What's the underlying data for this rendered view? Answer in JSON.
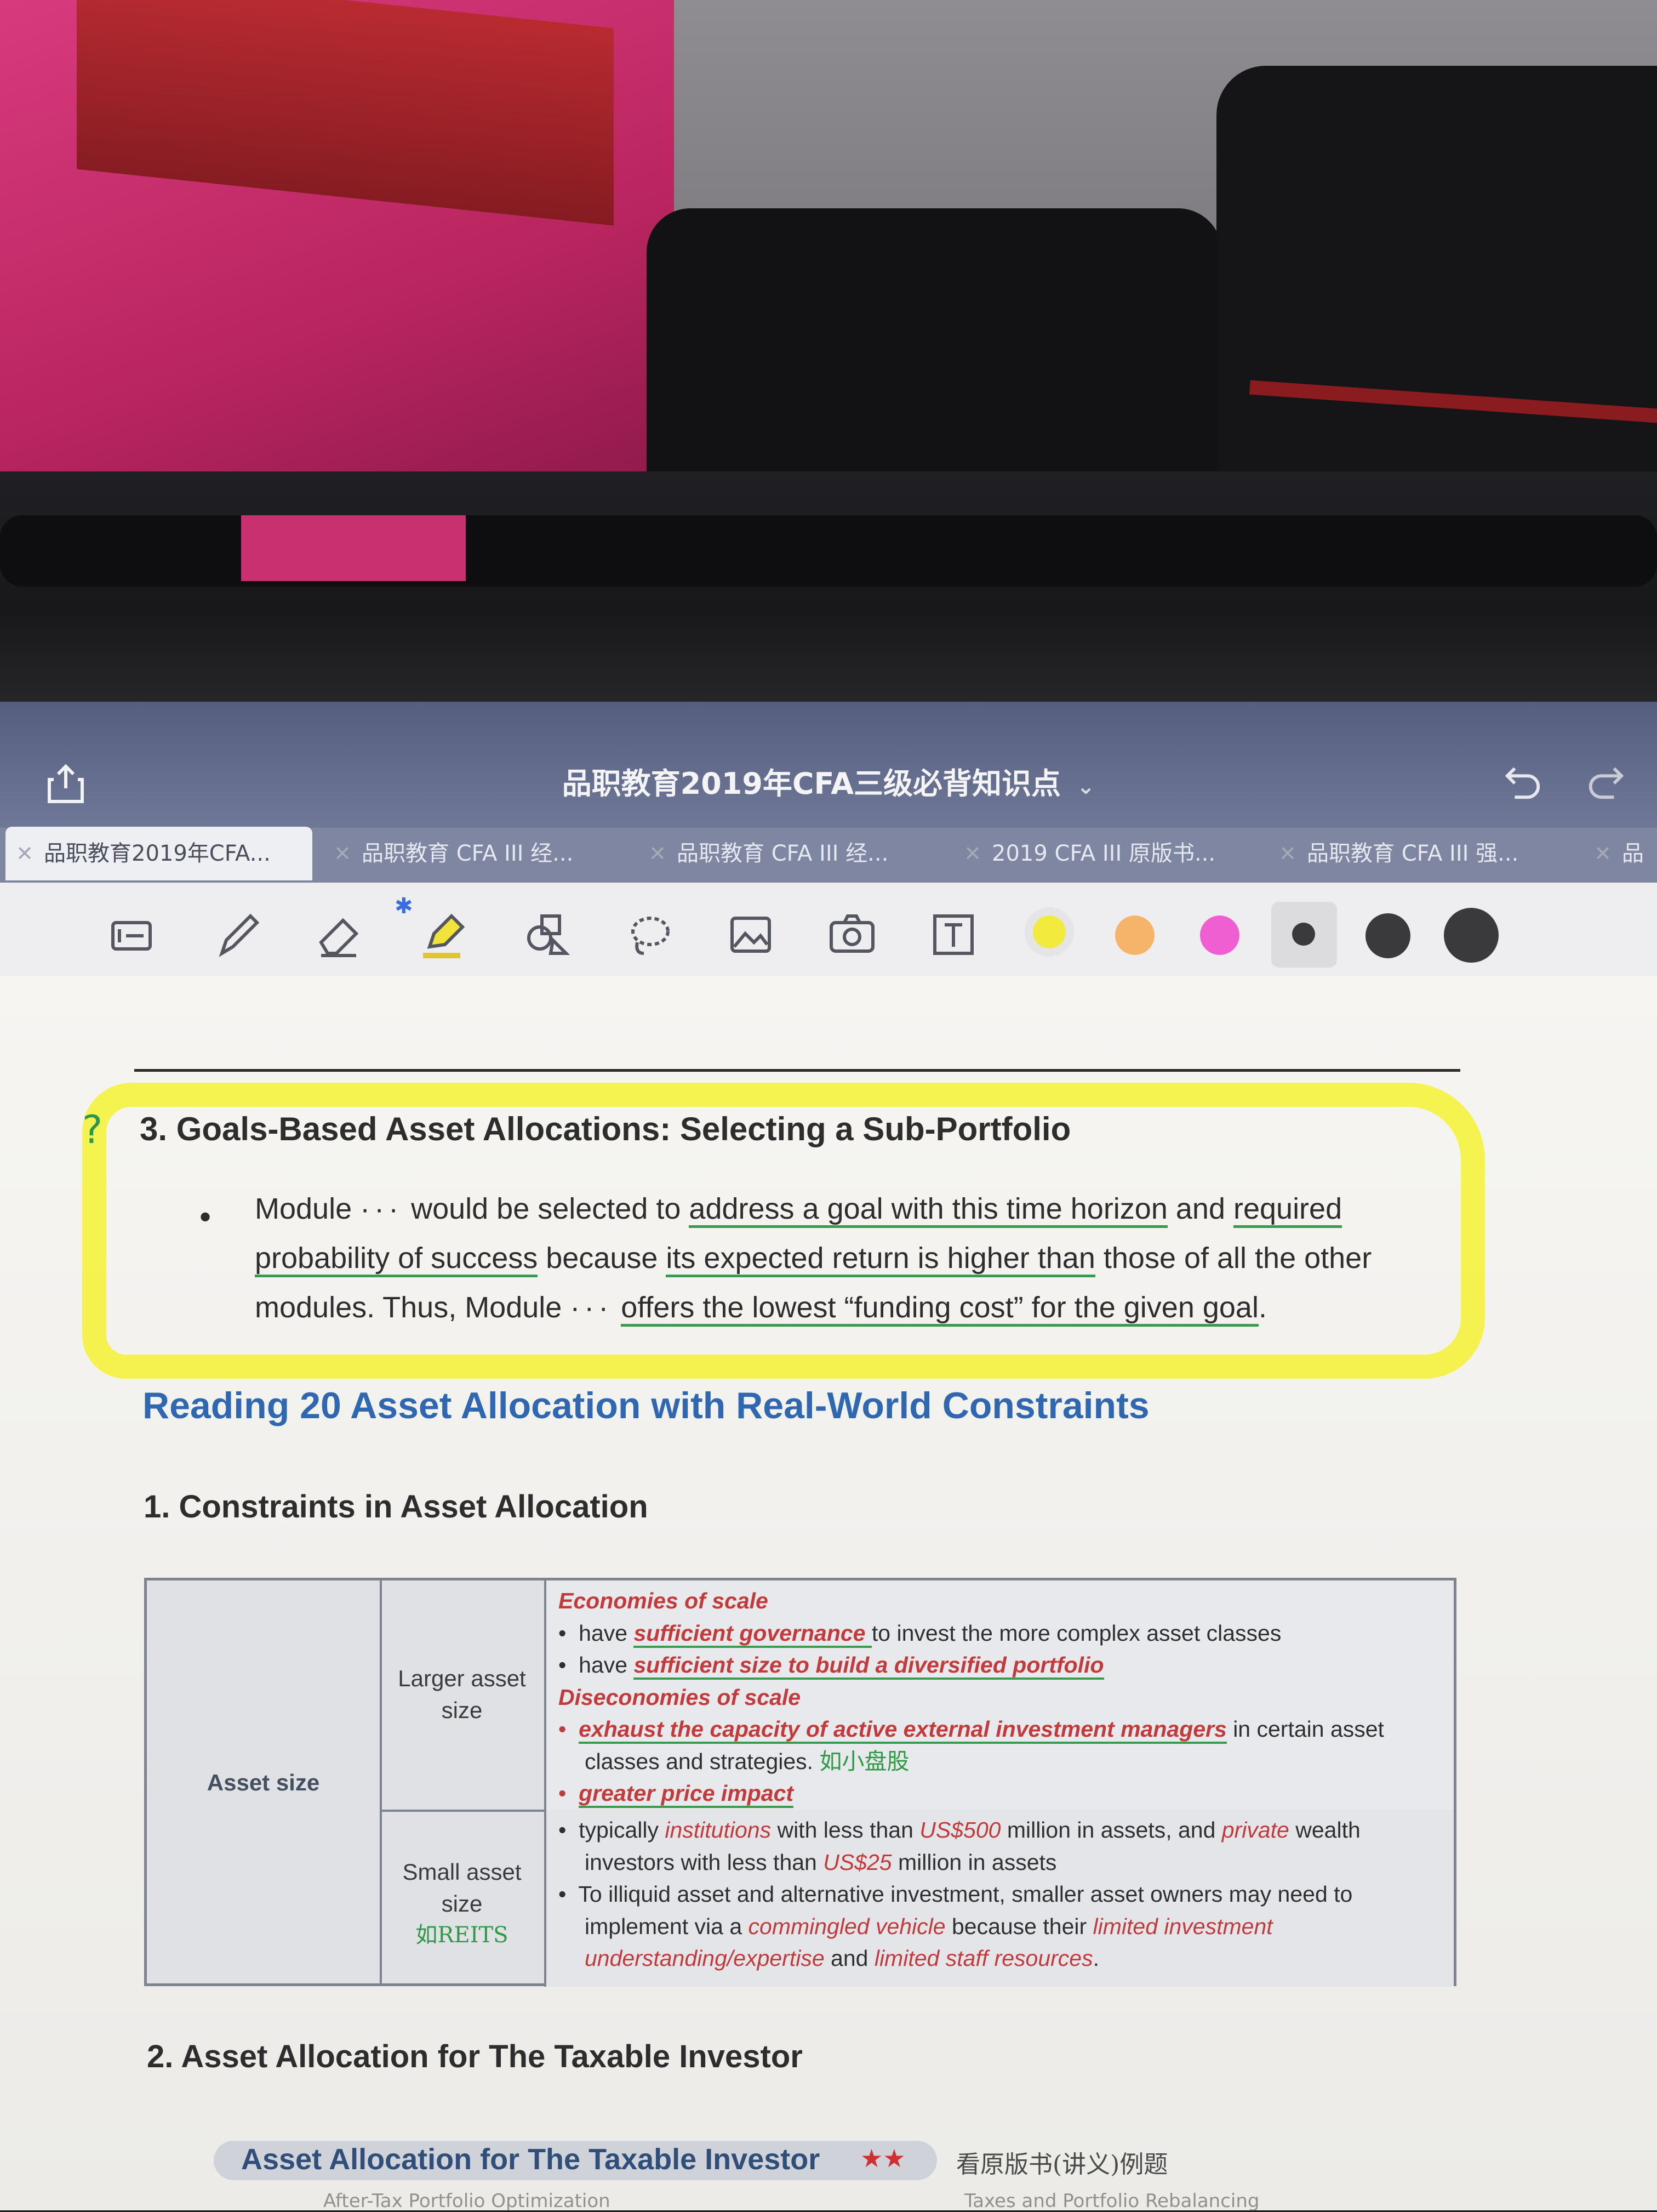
{
  "app": {
    "document_title": "品职教育2019年CFA三级必背知识点",
    "title_chevron": "⌄"
  },
  "tabs": [
    {
      "label": "品职教育2019年CFA...",
      "active": true
    },
    {
      "label": "品职教育 CFA III 经...",
      "active": false
    },
    {
      "label": "品职教育 CFA III 经...",
      "active": false
    },
    {
      "label": "2019 CFA III 原版书...",
      "active": false
    },
    {
      "label": "品职教育 CFA III 强...",
      "active": false
    },
    {
      "label": "品",
      "active": false
    }
  ],
  "toolbar": {
    "tools": [
      "page-view-icon",
      "pen-icon",
      "eraser-icon",
      "highlighter-icon",
      "shapes-icon",
      "lasso-icon",
      "image-icon",
      "camera-icon",
      "text-box-icon"
    ],
    "bluetooth_glyph": "✱",
    "colors": [
      "#f2ea3c",
      "#f5b46a",
      "#ef5fd2"
    ],
    "stroke_sizes": [
      "small",
      "medium",
      "large"
    ]
  },
  "content": {
    "question_mark": "?",
    "section3_title": "3.   Goals-Based Asset Allocations: Selecting a Sub-Portfolio",
    "bullet": "•",
    "para": {
      "p1": "Module ",
      "ellipsis1": "···",
      "p2": " would be selected to ",
      "u1": "address a goal with this time horizon",
      "p3": " and ",
      "u2": "required",
      "u3": "probability of success",
      "p4": " because ",
      "u4": "its expected return is higher than",
      "p5": " those of all the other modules. Thus, Module ",
      "ellipsis2": "···",
      "p6": " ",
      "u5": "offers the lowest “funding cost” for the given goal",
      "p7": "."
    },
    "reading_title": "Reading 20 Asset Allocation with Real-World Constraints",
    "section1_title": "1.   Constraints in Asset Allocation",
    "table": {
      "row_label": "Asset size",
      "larger_label": "Larger asset size",
      "small_label": "Small asset size",
      "small_handnote": "如REITS",
      "economies": "Economies of scale",
      "e1a": "have ",
      "e1b": "sufficient governance ",
      "e1c": "to invest the more complex asset classes",
      "e2a": "have ",
      "e2b": "sufficient size to build a diversified portfolio",
      "diseconomies": "Diseconomies of scale",
      "d1a": "exhaust the capacity of active external investment managers",
      "d1b": " in certain asset classes and strategies.",
      "d1hand": "如小盘股",
      "d2": "greater price impact",
      "s1a": "typically ",
      "s1b": "institutions",
      "s1c": " with less than ",
      "s1d": "US$500",
      "s1e": " million in assets, and ",
      "s1f": "private",
      "s1g": "wealth investors with less than ",
      "s1h": "US$25",
      "s1i": " million in assets",
      "s2a": "To illiquid asset and alternative investment, smaller asset owners may need to implement via a ",
      "s2b": "commingled vehicle",
      "s2c": " because their ",
      "s2d": "limited investment understanding/expertise",
      "s2e": " and ",
      "s2f": "limited staff resources",
      "s2g": "."
    },
    "section2_title": "2.   Asset Allocation for The Taxable Investor",
    "pill_title": "Asset Allocation for The Taxable Investor",
    "pill_stars": "★★",
    "pill_note": "看原版书(讲义)例题",
    "bottom_left": "After-Tax Portfolio Optimization",
    "bottom_right": "Taxes and Portfolio Rebalancing"
  }
}
